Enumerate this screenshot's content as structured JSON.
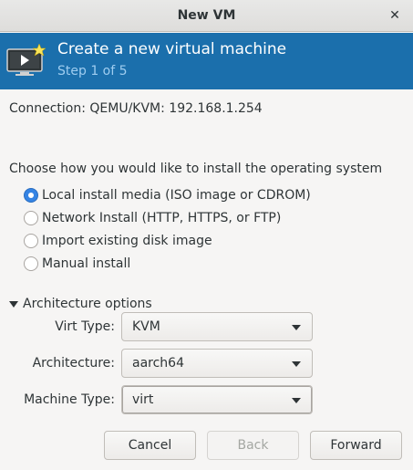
{
  "window": {
    "title": "New VM",
    "close_glyph": "✕"
  },
  "header": {
    "title": "Create a new virtual machine",
    "step": "Step 1 of 5",
    "icon": "vm-monitor-icon",
    "background": "#1b6fac"
  },
  "connection": "Connection: QEMU/KVM: 192.168.1.254",
  "install": {
    "question": "Choose how you would like to install the operating system",
    "options": [
      {
        "label": "Local install media (ISO image or CDROM)",
        "selected": true
      },
      {
        "label": "Network Install (HTTP, HTTPS, or FTP)",
        "selected": false
      },
      {
        "label": "Import existing disk image",
        "selected": false
      },
      {
        "label": "Manual install",
        "selected": false
      }
    ]
  },
  "arch_options": {
    "expander_label": "Architecture options",
    "expanded": true,
    "virt_type": {
      "label": "Virt Type:",
      "value": "KVM"
    },
    "architecture": {
      "label": "Architecture:",
      "value": "aarch64"
    },
    "machine_type": {
      "label": "Machine Type:",
      "value": "virt"
    }
  },
  "buttons": {
    "cancel": "Cancel",
    "back": "Back",
    "forward": "Forward"
  },
  "colors": {
    "accent": "#3584e4",
    "header_step": "#9fcdf0"
  }
}
